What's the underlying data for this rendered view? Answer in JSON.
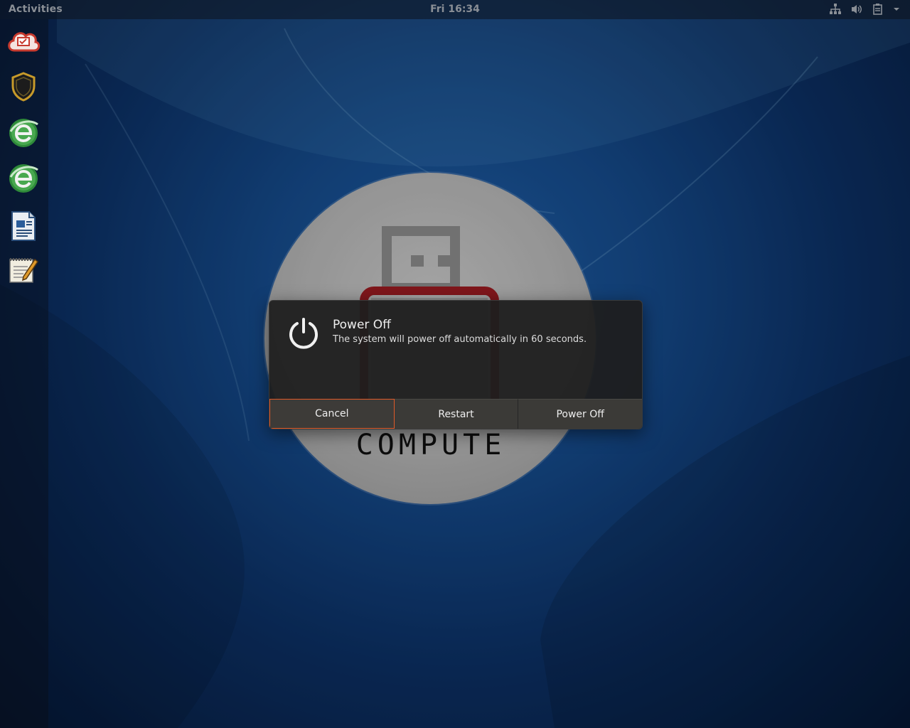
{
  "topbar": {
    "activities_label": "Activities",
    "clock": "Fri 16:34",
    "tray_icons": [
      "network-icon",
      "volume-icon",
      "clipboard-icon",
      "menu-arrow-icon"
    ]
  },
  "dock": {
    "items": [
      "cloud-monitor-icon",
      "shield-icon",
      "browser-icon",
      "browser-icon",
      "document-viewer-icon",
      "text-editor-icon"
    ]
  },
  "logo": {
    "text": "COMPUTE"
  },
  "dialog": {
    "title": "Power Off",
    "message": "The system will power off automatically in 60 seconds.",
    "buttons": {
      "cancel": "Cancel",
      "restart": "Restart",
      "power_off": "Power Off"
    }
  },
  "colors": {
    "focus_accent": "#e05a28",
    "dialog_bg": "#1e1e1e",
    "button_bg": "#3b3a37"
  }
}
